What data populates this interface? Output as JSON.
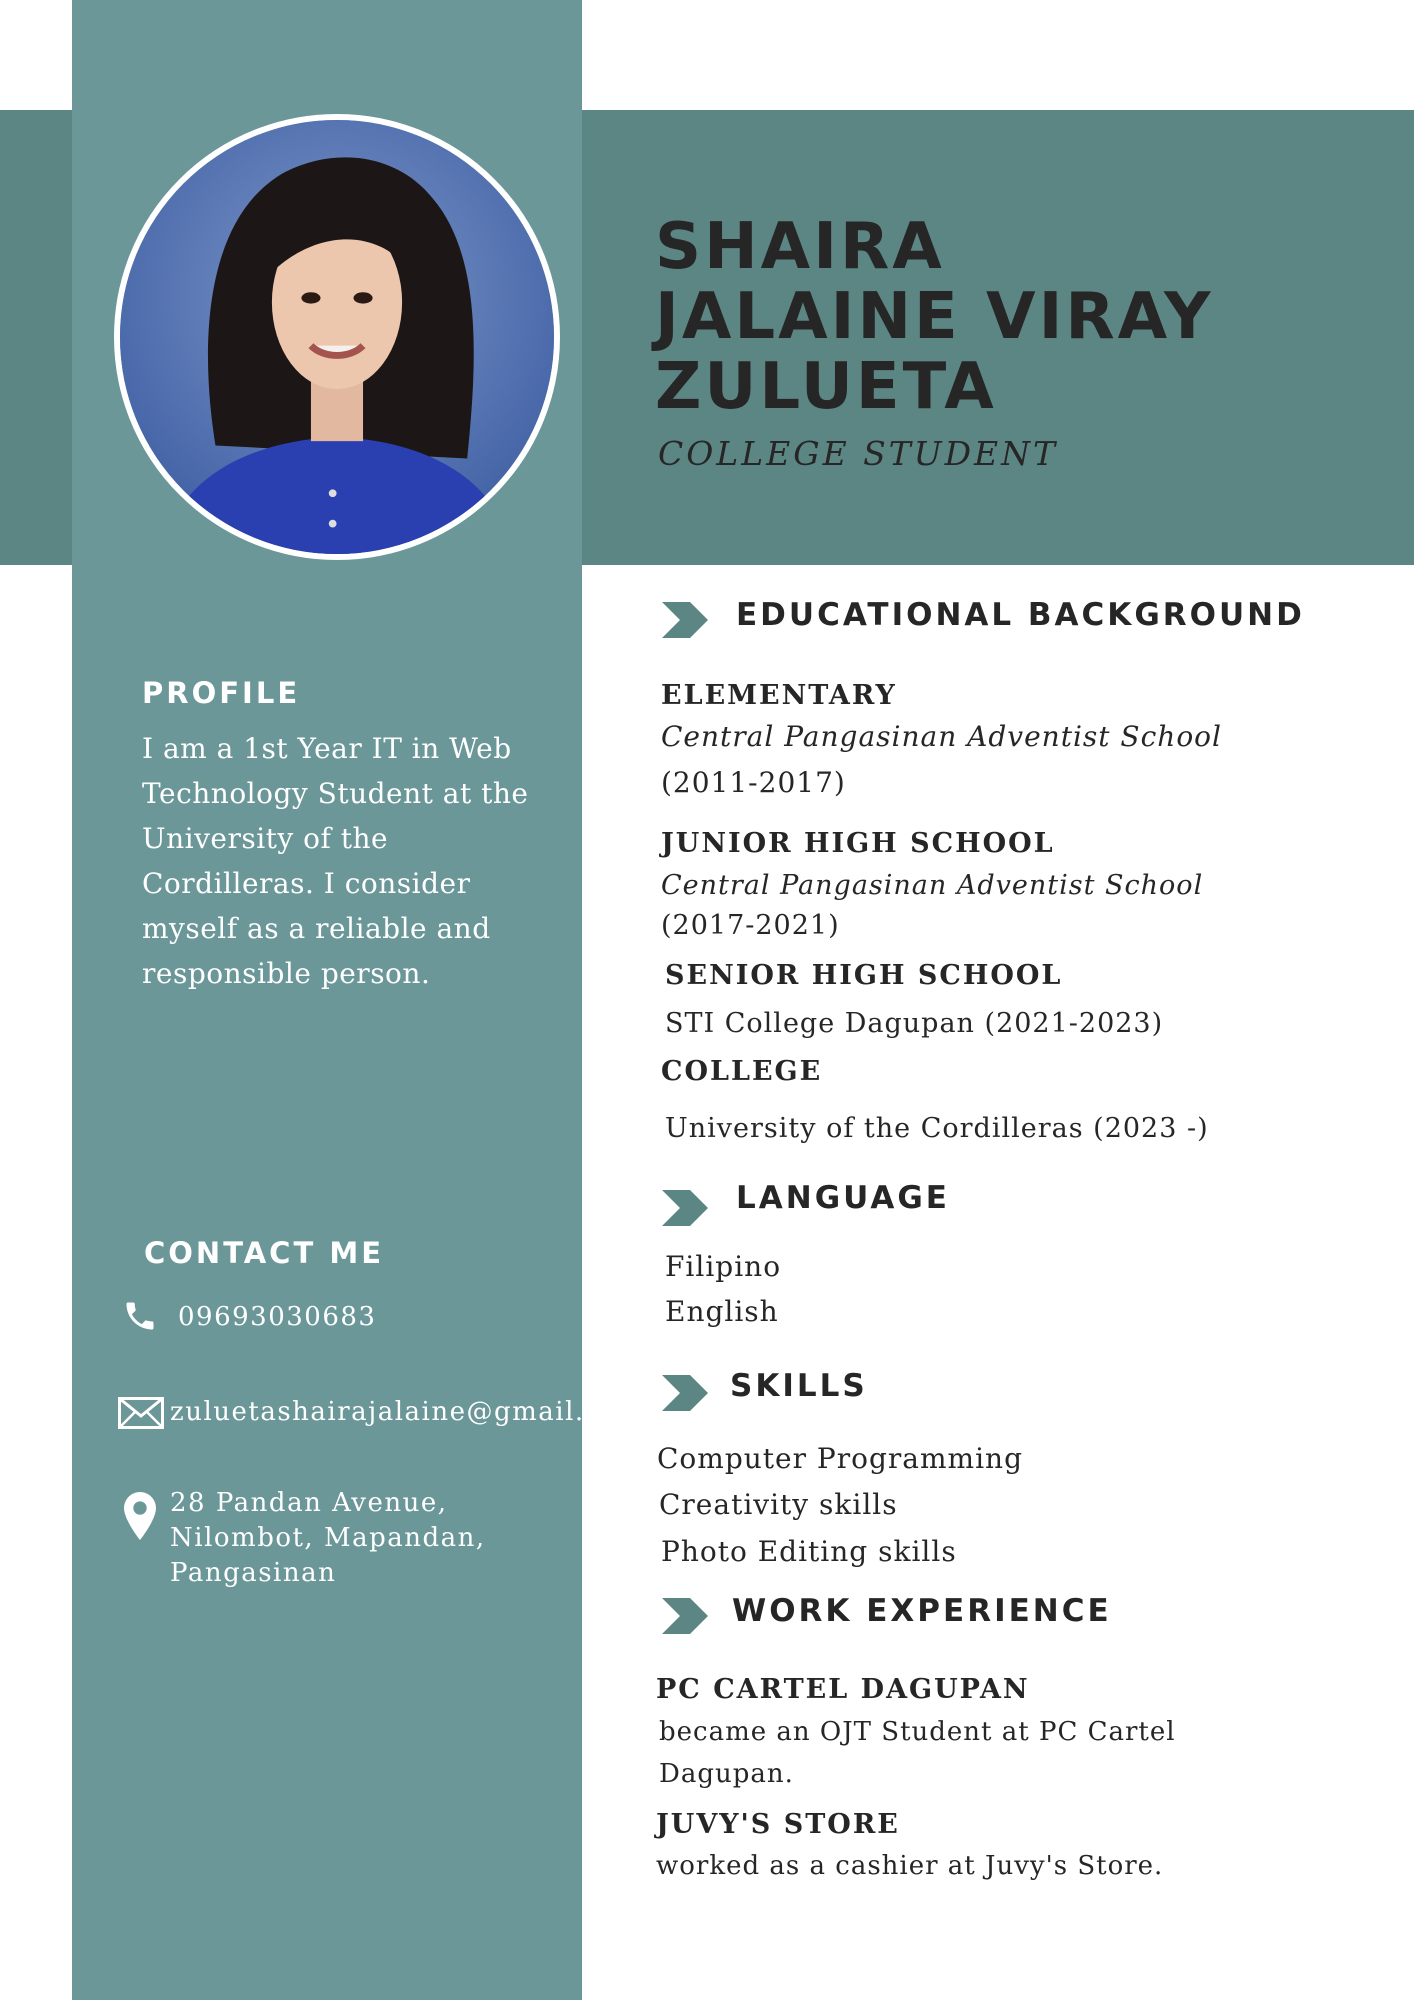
{
  "header": {
    "name_lines": [
      "SHAIRA",
      "JALAINE VIRAY",
      "ZULUETA"
    ],
    "role": "COLLEGE STUDENT"
  },
  "profile": {
    "heading": "PROFILE",
    "text": "I am a 1st Year IT in Web Technology Student at the University of the Cordilleras. I consider myself as a reliable and responsible person."
  },
  "contact": {
    "heading": "CONTACT ME",
    "phone": "09693030683",
    "email": "zuluetashairajalaine@gmail.com",
    "address_lines": [
      "28 Pandan Avenue,",
      "Nilombot, Mapandan,",
      "Pangasinan"
    ]
  },
  "education": {
    "heading": "EDUCATIONAL BACKGROUND",
    "elementary_label": "ELEMENTARY",
    "elementary_school": "Central Pangasinan Adventist School",
    "elementary_years": "(2011-2017)",
    "junior_label": "JUNIOR HIGH SCHOOL",
    "junior_school": "Central Pangasinan Adventist School",
    "junior_years": "(2017-2021)",
    "senior_label": "SENIOR HIGH SCHOOL",
    "senior_school": "STI College Dagupan (2021-2023)",
    "college_label": "COLLEGE",
    "college_school": "University of the Cordilleras (2023 -)"
  },
  "language": {
    "heading": "LANGUAGE",
    "items": [
      "Filipino",
      "English"
    ]
  },
  "skills": {
    "heading": "SKILLS",
    "items": [
      "Computer Programming",
      "Creativity skills",
      "Photo Editing skills"
    ]
  },
  "work": {
    "heading": "WORK EXPERIENCE",
    "job1_title": "PC CARTEL DAGUPAN",
    "job1_desc_lines": [
      "became an OJT Student at PC Cartel",
      "Dagupan."
    ],
    "job2_title": "JUVY'S STORE",
    "job2_desc": "worked as a cashier at Juvy's Store."
  },
  "colors": {
    "sidebar": "#6b9798",
    "band": "#5c8684",
    "text_dark": "#262626",
    "text_light": "#ffffff"
  }
}
